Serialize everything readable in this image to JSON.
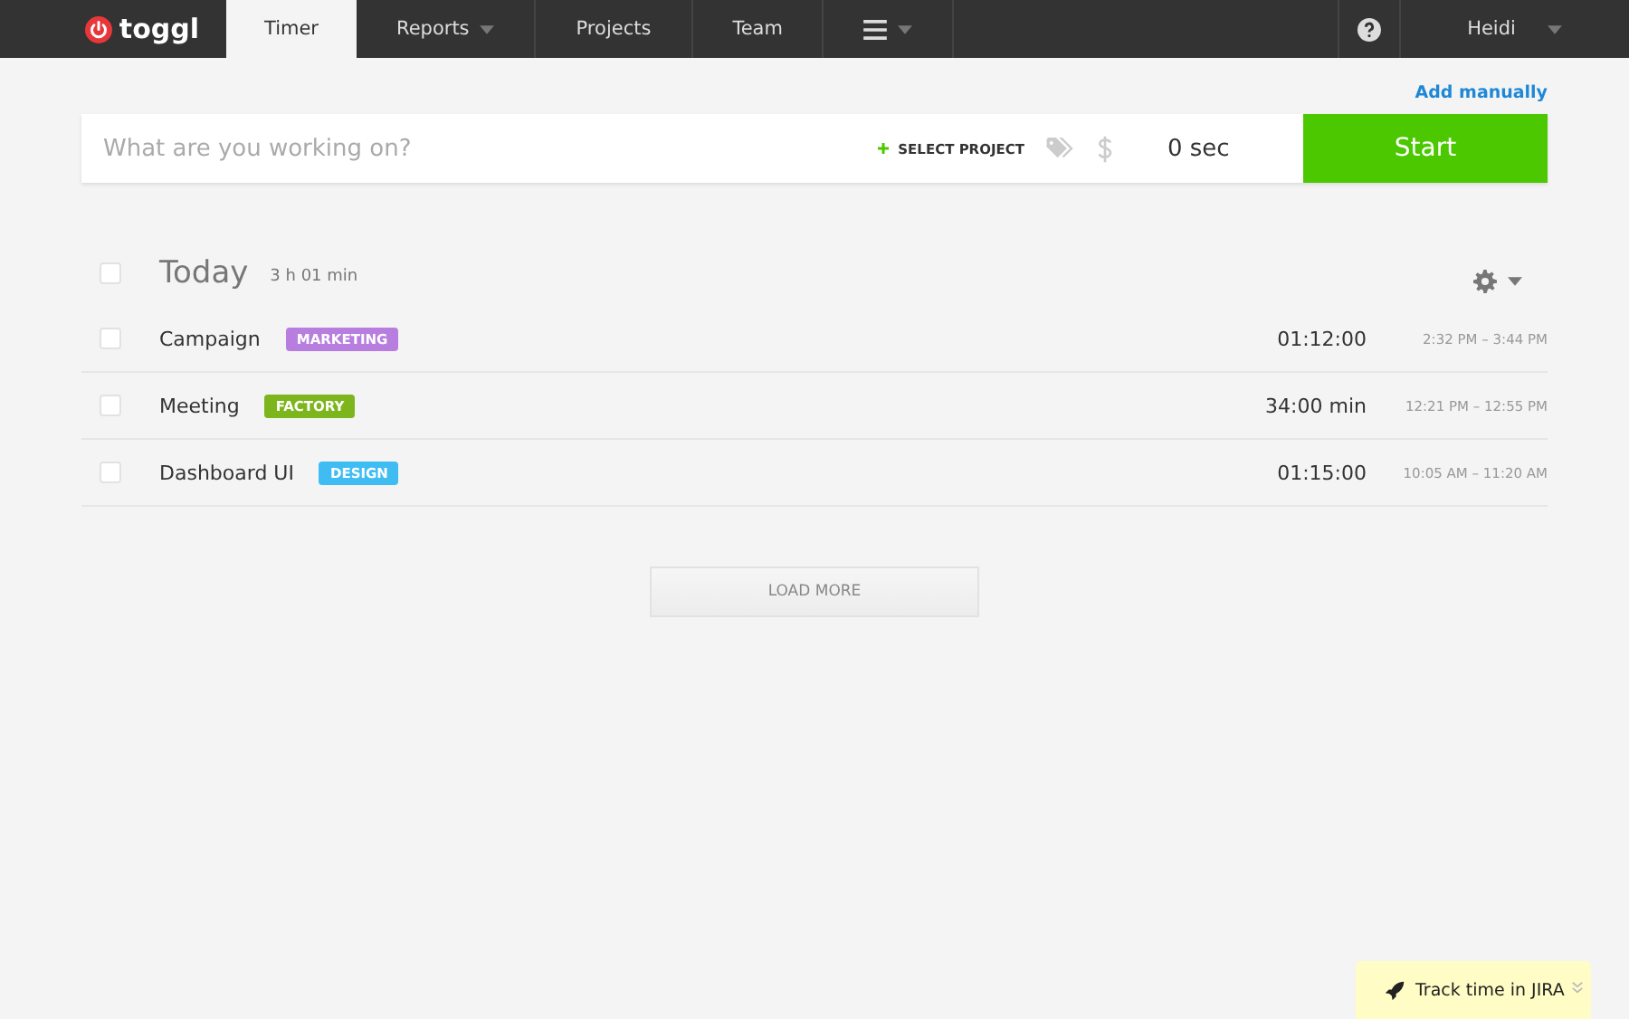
{
  "logo": {
    "text": "toggl"
  },
  "nav": [
    {
      "label": "Timer",
      "selected": true,
      "dropdown": false
    },
    {
      "label": "Reports",
      "selected": false,
      "dropdown": true
    },
    {
      "label": "Projects",
      "selected": false,
      "dropdown": false
    },
    {
      "label": "Team",
      "selected": false,
      "dropdown": false
    }
  ],
  "user": {
    "name": "Heidi"
  },
  "add_manually": "Add manually",
  "timer": {
    "placeholder": "What are you working on?",
    "select_project": "SELECT PROJECT",
    "duration": "0 sec",
    "start": "Start"
  },
  "day": {
    "title": "Today",
    "total": "3 h 01 min",
    "checked": false
  },
  "entries": [
    {
      "description": "Campaign",
      "tag": "MARKETING",
      "color": "#b77ee0",
      "duration": "01:12:00",
      "range": "2:32 PM – 3:44 PM",
      "checked": false
    },
    {
      "description": "Meeting",
      "tag": "FACTORY",
      "color": "#7cb51c",
      "duration": "34:00 min",
      "range": "12:21 PM – 12:55 PM",
      "checked": false
    },
    {
      "description": "Dashboard UI",
      "tag": "DESIGN",
      "color": "#3fbdf2",
      "duration": "01:15:00",
      "range": "10:05 AM – 11:20 AM",
      "checked": false
    }
  ],
  "load_more": "LOAD MORE",
  "promo": {
    "text": "Track time in JIRA"
  }
}
